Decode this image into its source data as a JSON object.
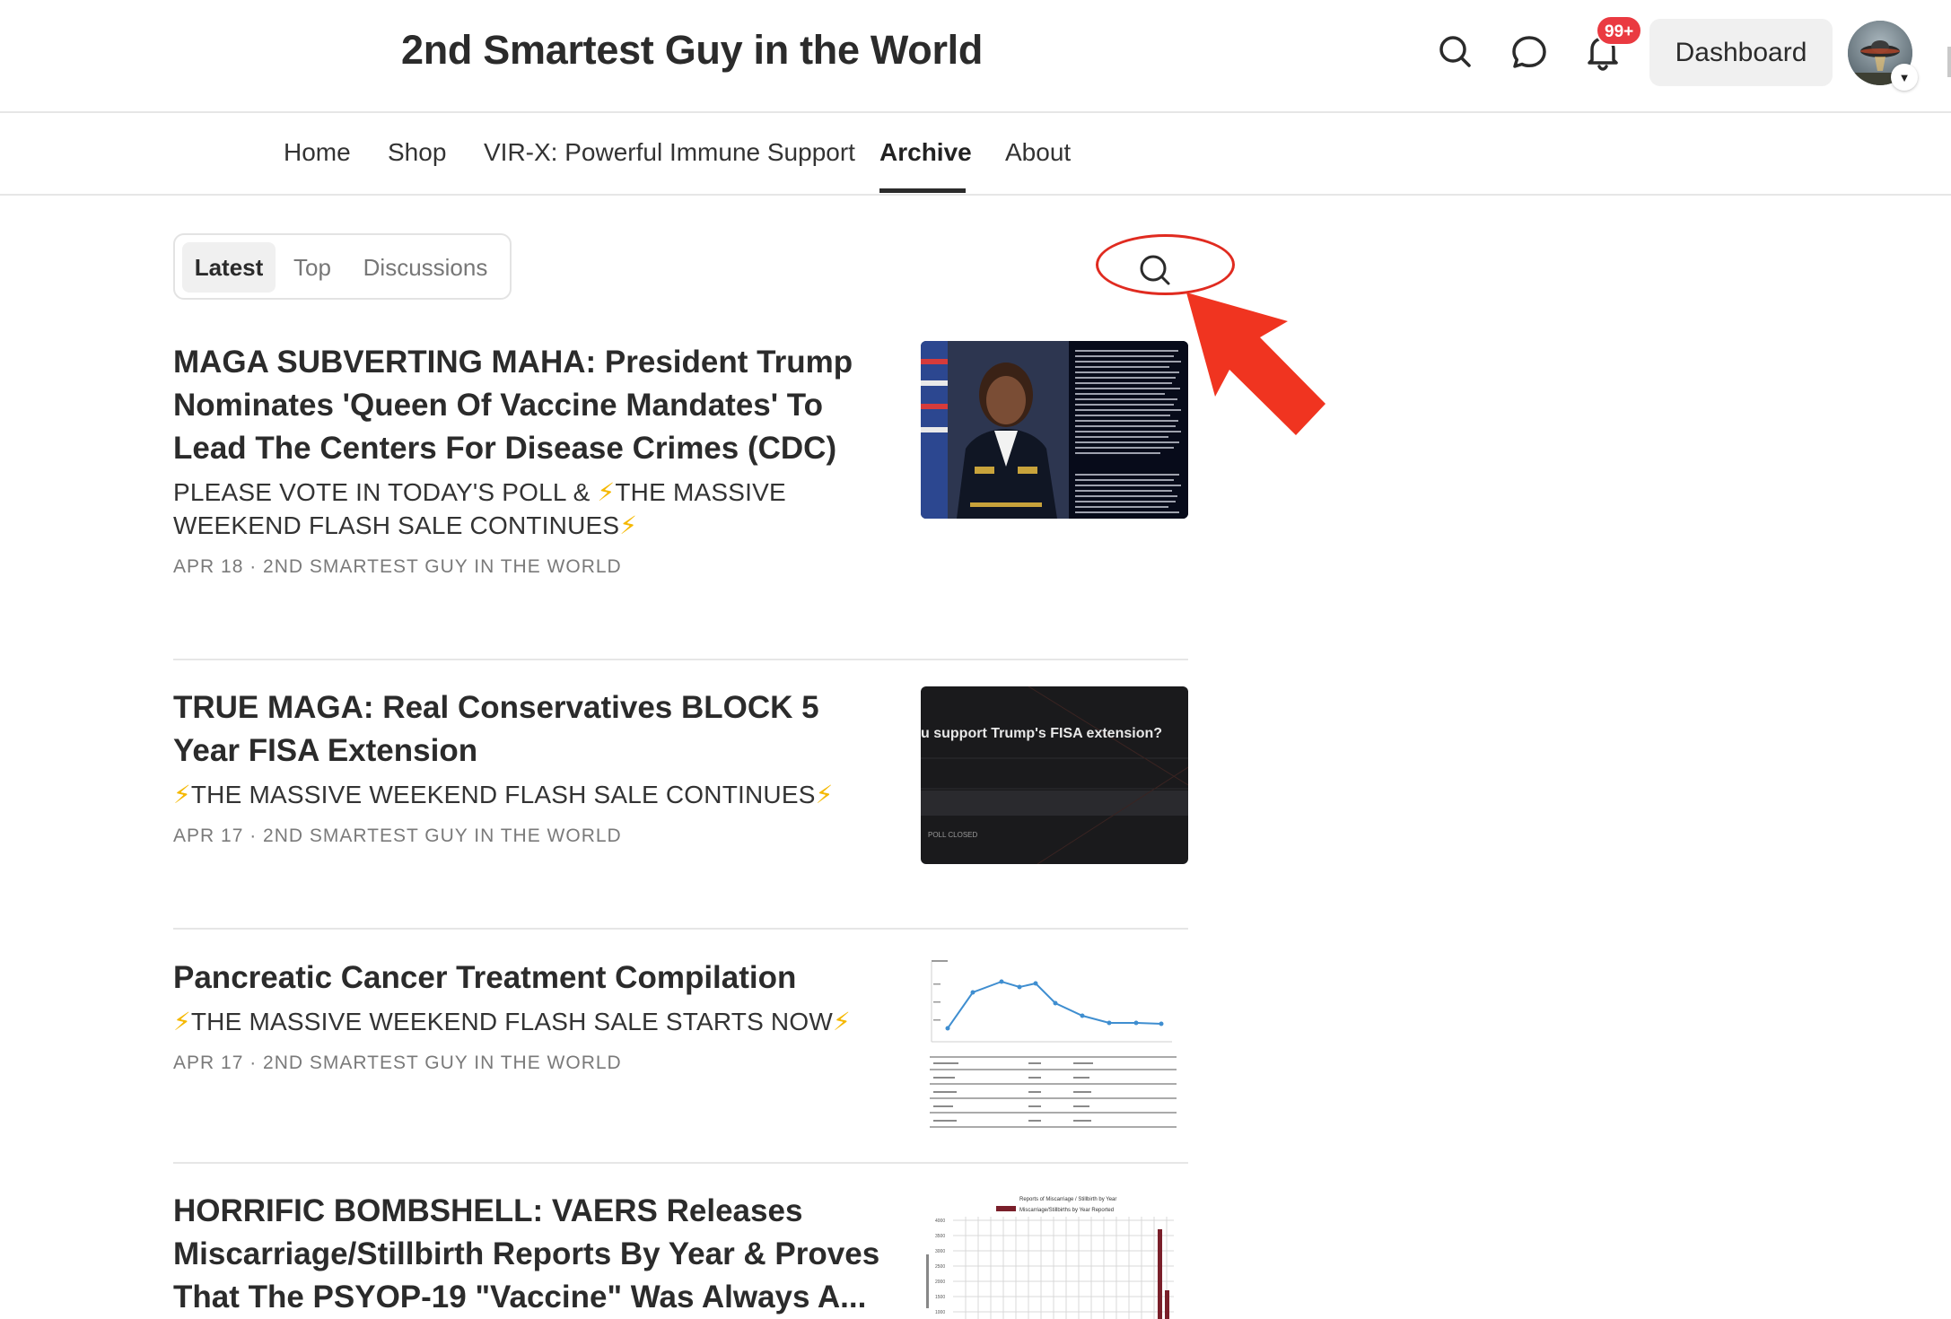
{
  "header": {
    "site_title": "2nd Smartest Guy in the World",
    "notification_badge": "99+",
    "dashboard_label": "Dashboard",
    "icons": [
      "search-icon",
      "chat-icon",
      "bell-icon",
      "avatar"
    ]
  },
  "nav": {
    "items": [
      "Home",
      "Shop",
      "VIR-X: Powerful Immune Support",
      "Archive",
      "About"
    ],
    "active": "Archive"
  },
  "filters": {
    "tabs": [
      "Latest",
      "Top",
      "Discussions"
    ],
    "active": "Latest"
  },
  "posts": [
    {
      "title": "MAGA SUBVERTING MAHA: President Trump Nominates 'Queen Of Vaccine Mandates' To Lead The Centers For Disease Crimes (CDC)",
      "subtitle_pre": "PLEASE VOTE IN TODAY'S POLL & ",
      "subtitle_mid": "THE MASSIVE WEEKEND FLASH SALE CONTINUES",
      "date": "APR 18",
      "author": "2ND SMARTEST GUY IN THE WORLD"
    },
    {
      "title": "TRUE MAGA: Real Conservatives BLOCK 5 Year FISA Extension",
      "subtitle": "THE MASSIVE WEEKEND FLASH SALE CONTINUES",
      "date": "APR 17",
      "author": "2ND SMARTEST GUY IN THE WORLD",
      "thumb_question": "u support Trump's FISA extension?",
      "thumb_footer": "POLL CLOSED"
    },
    {
      "title": "Pancreatic Cancer Treatment Compilation",
      "subtitle": "THE MASSIVE WEEKEND FLASH SALE STARTS NOW",
      "date": "APR 17",
      "author": "2ND SMARTEST GUY IN THE WORLD"
    },
    {
      "title": "HORRIFIC BOMBSHELL: VAERS Releases Miscarriage/Stillbirth Reports By Year & Proves That The PSYOP-19 \"Vaccine\" Was Always A...",
      "thumb_chart_title": "Reports of Miscarriage / Stillbirth by Year",
      "thumb_chart_legend": "Miscarriage/Stillbirths by Year Reported",
      "thumb_y_ticks": [
        "4000",
        "3500",
        "3000",
        "2500",
        "2000",
        "1500",
        "1000"
      ]
    }
  ],
  "colors": {
    "annotation_red": "#e02b20",
    "badge_red": "#ea3a41",
    "bolt_yellow": "#f5b800"
  }
}
